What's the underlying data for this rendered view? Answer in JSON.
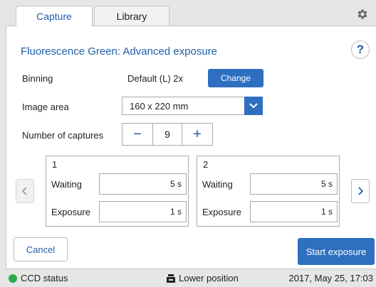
{
  "tabs": {
    "capture": "Capture",
    "library": "Library"
  },
  "header": {
    "title": "Fluorescence Green: Advanced exposure",
    "help_label": "?"
  },
  "binning": {
    "label": "Binning",
    "value": "Default (L) 2x",
    "change_label": "Change"
  },
  "image_area": {
    "label": "Image area",
    "selected": "160 x 220 mm"
  },
  "captures": {
    "label": "Number of captures",
    "minus": "−",
    "value": "9",
    "plus": "+"
  },
  "capture_items": [
    {
      "number": "1",
      "waiting_label": "Waiting",
      "waiting_value": "5 s",
      "exposure_label": "Exposure",
      "exposure_value": "1 s"
    },
    {
      "number": "2",
      "waiting_label": "Waiting",
      "waiting_value": "5 s",
      "exposure_label": "Exposure",
      "exposure_value": "1 s"
    }
  ],
  "actions": {
    "cancel": "Cancel",
    "start": "Start exposure"
  },
  "status": {
    "ccd": "CCD status",
    "ccd_color": "#2da94f",
    "position": "Lower position",
    "datetime": "2017, May 25, 17:03"
  },
  "colors": {
    "accent": "#2f6fc0",
    "title": "#1f5fa8"
  }
}
